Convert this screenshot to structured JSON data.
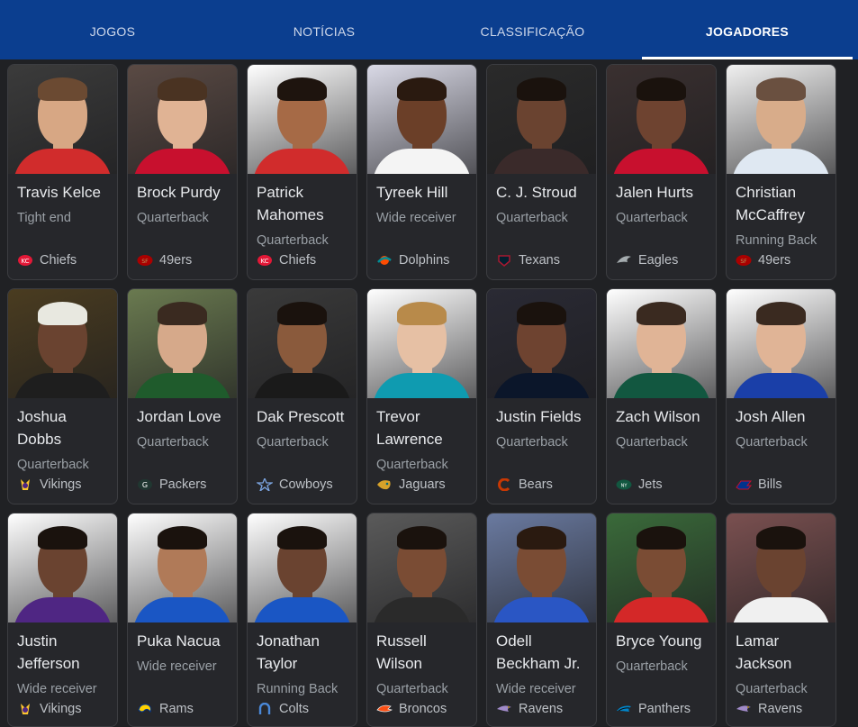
{
  "tabs": [
    {
      "label": "JOGOS",
      "active": false
    },
    {
      "label": "NOTÍCIAS",
      "active": false
    },
    {
      "label": "CLASSIFICAÇÃO",
      "active": false
    },
    {
      "label": "JOGADORES",
      "active": true
    }
  ],
  "players": [
    {
      "name": "Travis Kelce",
      "position": "Tight end",
      "team": "Chiefs",
      "icon": "chiefs-logo-icon",
      "color": "#d12c2c",
      "skin": "#d7a784",
      "hair": "#6b4a32",
      "bg": "#3b3b3b"
    },
    {
      "name": "Brock Purdy",
      "position": "Quarterback",
      "team": "49ers",
      "icon": "49ers-logo-icon",
      "color": "#c8102e",
      "skin": "#e0b394",
      "hair": "#4a3322",
      "bg": "#5a4a44"
    },
    {
      "name": "Patrick Mahomes",
      "position": "Quarterback",
      "team": "Chiefs",
      "icon": "chiefs-logo-icon",
      "color": "#d12c2c",
      "skin": "#a66a46",
      "hair": "#1e140e",
      "bg": "#ffffff"
    },
    {
      "name": "Tyreek Hill",
      "position": "Wide receiver",
      "team": "Dolphins",
      "icon": "dolphins-logo-icon",
      "color": "#f4f4f4",
      "skin": "#6b3f28",
      "hair": "#2a1a10",
      "bg": "#d9d9e6"
    },
    {
      "name": "C. J. Stroud",
      "position": "Quarterback",
      "team": "Texans",
      "icon": "texans-logo-icon",
      "color": "#3a2a2a",
      "skin": "#6a4330",
      "hair": "#1a120d",
      "bg": "#2a2a2a"
    },
    {
      "name": "Jalen Hurts",
      "position": "Quarterback",
      "team": "Eagles",
      "icon": "eagles-logo-icon",
      "color": "#c8102e",
      "skin": "#6e4330",
      "hair": "#1a120d",
      "bg": "#3a3030"
    },
    {
      "name": "Christian McCaffrey",
      "position": "Running Back",
      "team": "49ers",
      "icon": "49ers-logo-icon",
      "color": "#dfe8f2",
      "skin": "#d8ac8a",
      "hair": "#6a5040",
      "bg": "#f0f0f0"
    },
    {
      "name": "Joshua Dobbs",
      "position": "Quarterback",
      "team": "Vikings",
      "icon": "vikings-logo-icon",
      "color": "#1e1e1e",
      "skin": "#6a4330",
      "hair": "#e8e8e0",
      "bg": "#4a3c20"
    },
    {
      "name": "Jordan Love",
      "position": "Quarterback",
      "team": "Packers",
      "icon": "packers-logo-icon",
      "color": "#1f5b2c",
      "skin": "#d6a98a",
      "hair": "#3a2a20",
      "bg": "#6a7a50"
    },
    {
      "name": "Dak Prescott",
      "position": "Quarterback",
      "team": "Cowboys",
      "icon": "cowboys-logo-icon",
      "color": "#1a1a1a",
      "skin": "#8a5a3c",
      "hair": "#1a120d",
      "bg": "#3a3a3a"
    },
    {
      "name": "Trevor Lawrence",
      "position": "Quarterback",
      "team": "Jaguars",
      "icon": "jaguars-logo-icon",
      "color": "#0f9bb0",
      "skin": "#e6c0a4",
      "hair": "#b88a4a",
      "bg": "#ffffff"
    },
    {
      "name": "Justin Fields",
      "position": "Quarterback",
      "team": "Bears",
      "icon": "bears-logo-icon",
      "color": "#0b162a",
      "skin": "#6e4330",
      "hair": "#1a120d",
      "bg": "#2a2a34"
    },
    {
      "name": "Zach Wilson",
      "position": "Quarterback",
      "team": "Jets",
      "icon": "jets-logo-icon",
      "color": "#125740",
      "skin": "#e0b496",
      "hair": "#3a2a20",
      "bg": "#ffffff"
    },
    {
      "name": "Josh Allen",
      "position": "Quarterback",
      "team": "Bills",
      "icon": "bills-logo-icon",
      "color": "#1a3fa8",
      "skin": "#e0b496",
      "hair": "#3a2a20",
      "bg": "#ffffff"
    },
    {
      "name": "Justin Jefferson",
      "position": "Wide receiver",
      "team": "Vikings",
      "icon": "vikings-logo-icon",
      "color": "#4f2683",
      "skin": "#6a4330",
      "hair": "#1a120d",
      "bg": "#ffffff"
    },
    {
      "name": "Puka Nacua",
      "position": "Wide receiver",
      "team": "Rams",
      "icon": "rams-logo-icon",
      "color": "#1a56c4",
      "skin": "#b07a58",
      "hair": "#1a120d",
      "bg": "#ffffff"
    },
    {
      "name": "Jonathan Taylor",
      "position": "Running Back",
      "team": "Colts",
      "icon": "colts-logo-icon",
      "color": "#1a56c4",
      "skin": "#6a4330",
      "hair": "#1a120d",
      "bg": "#ffffff"
    },
    {
      "name": "Russell Wilson",
      "position": "Quarterback",
      "team": "Broncos",
      "icon": "broncos-logo-icon",
      "color": "#2a2a2a",
      "skin": "#7a4c34",
      "hair": "#1a120d",
      "bg": "#5a5a5a"
    },
    {
      "name": "Odell Beckham Jr.",
      "position": "Wide receiver",
      "team": "Ravens",
      "icon": "ravens-logo-icon",
      "color": "#2a56c4",
      "skin": "#7a4c34",
      "hair": "#2a1a10",
      "bg": "#6a7aa0"
    },
    {
      "name": "Bryce Young",
      "position": "Quarterback",
      "team": "Panthers",
      "icon": "panthers-logo-icon",
      "color": "#d42828",
      "skin": "#7a4c34",
      "hair": "#1a120d",
      "bg": "#3a6a3a"
    },
    {
      "name": "Lamar Jackson",
      "position": "Quarterback",
      "team": "Ravens",
      "icon": "ravens-logo-icon",
      "color": "#f0f0f0",
      "skin": "#6a4330",
      "hair": "#1a120d",
      "bg": "#7a5050"
    }
  ]
}
